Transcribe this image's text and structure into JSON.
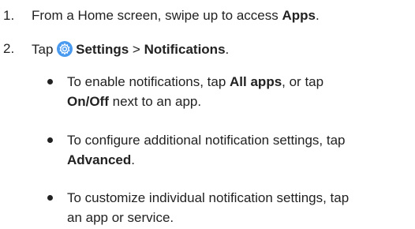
{
  "steps": [
    {
      "number": "1.",
      "text": "From a Home screen, swipe up to access ",
      "bold": "Apps",
      "suffix": "."
    },
    {
      "number": "2.",
      "prefix": "Tap ",
      "icon": "settings-gear-icon",
      "bold1": "Settings",
      "separator": " > ",
      "bold2": "Notifications",
      "suffix": "."
    }
  ],
  "bullets": [
    {
      "t1": "To enable notifications, tap ",
      "b1": "All apps",
      "t2": ", or tap",
      "b2": "On/Off",
      "t3": " next to an app."
    },
    {
      "t1": "To configure additional notification settings, tap",
      "b1": "Advanced",
      "t2": "."
    },
    {
      "t1": "To customize individual notification settings, tap",
      "t2": "an app or service."
    }
  ],
  "colors": {
    "text": "#222222",
    "icon_bg": "#4a9bf0",
    "icon_fg": "#ffffff"
  }
}
